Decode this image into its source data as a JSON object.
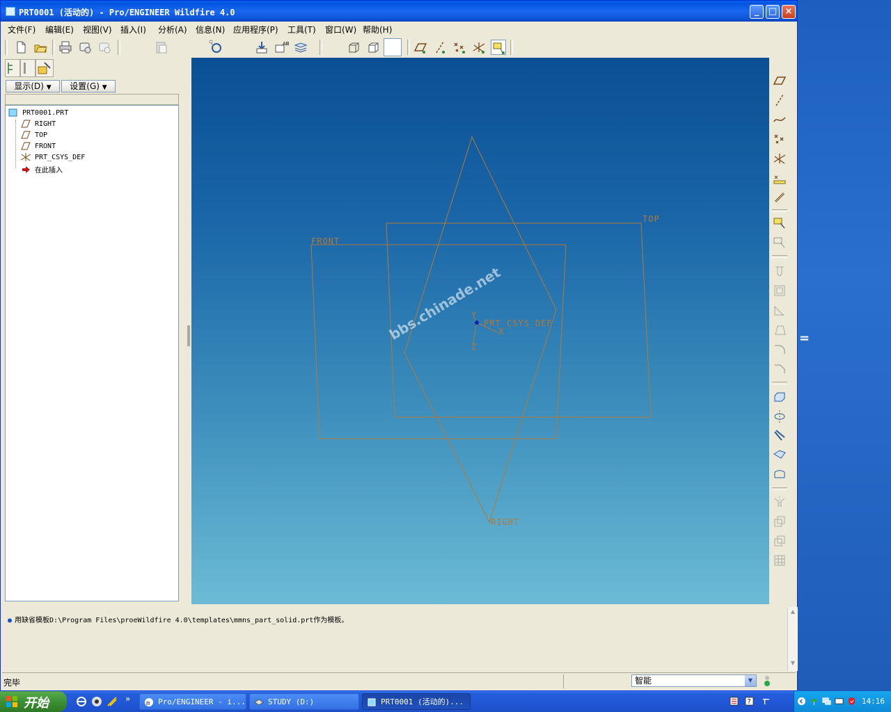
{
  "window": {
    "title": "PRT0001 (活动的) - Pro/ENGINEER Wildfire 4.0",
    "min_label": "_",
    "max_label": "□",
    "close_label": "×"
  },
  "menu": [
    {
      "label": "文件(F)"
    },
    {
      "label": "编辑(E)"
    },
    {
      "label": "视图(V)"
    },
    {
      "label": "插入(I)"
    },
    {
      "label": "分析(A)"
    },
    {
      "label": "信息(N)"
    },
    {
      "label": "应用程序(P)"
    },
    {
      "label": "工具(T)"
    },
    {
      "label": "窗口(W)"
    },
    {
      "label": "帮助(H)"
    }
  ],
  "navigator": {
    "show_button": "显示(D)",
    "settings_button": "设置(G)",
    "tree": [
      {
        "label": "PRT0001.PRT",
        "icon": "part-icon"
      },
      {
        "label": "RIGHT",
        "icon": "datum-plane-icon"
      },
      {
        "label": "TOP",
        "icon": "datum-plane-icon"
      },
      {
        "label": "FRONT",
        "icon": "datum-plane-icon"
      },
      {
        "label": "PRT_CSYS_DEF",
        "icon": "csys-icon"
      },
      {
        "label": "在此插入",
        "icon": "insert-arrow-icon"
      }
    ]
  },
  "graphics": {
    "labels": {
      "top": "TOP",
      "front": "FRONT",
      "right": "RIGHT",
      "csys": "PRT_CSYS_DEF",
      "csys_x": "X",
      "csys_y": "Y",
      "csys_z": "Z"
    },
    "watermark": "bbs.chinade.net",
    "datum_color": "#b07a3a"
  },
  "message": "用缺省模板D:\\Program Files\\proeWildfire 4.0\\templates\\mmns_part_solid.prt作为模板。",
  "status": {
    "text": "完毕",
    "filter_value": "智能"
  },
  "taskbar": {
    "start_label": "开始",
    "chevron": "»",
    "tasks": [
      {
        "label": "Pro/ENGINEER - i...",
        "active": false
      },
      {
        "label": "STUDY (D:)",
        "active": false
      },
      {
        "label": "PRT0001 (活动的)...",
        "active": true
      }
    ],
    "clock": "14:16"
  }
}
